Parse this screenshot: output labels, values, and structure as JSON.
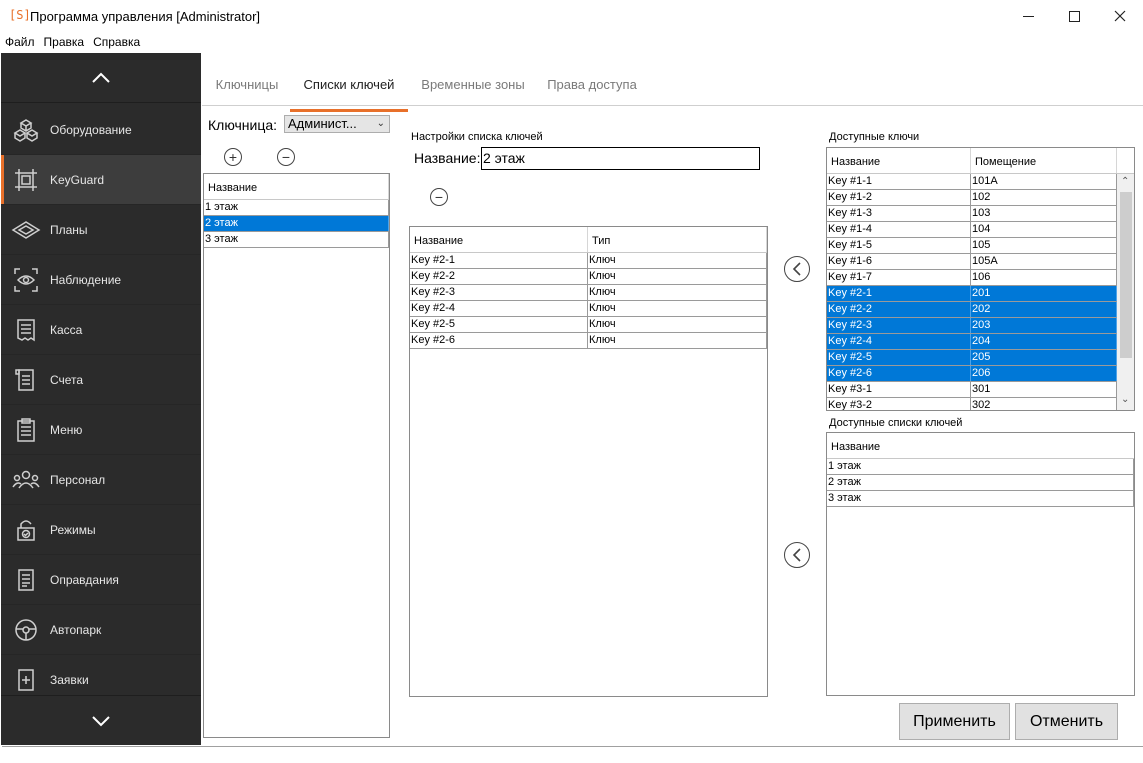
{
  "window": {
    "logo": "[S]",
    "title": "Программа управления [Administrator]"
  },
  "menu": [
    "Файл",
    "Правка",
    "Справка"
  ],
  "sidebar": {
    "items": [
      {
        "label": "Оборудование",
        "icon": "equipment-icon"
      },
      {
        "label": "KeyGuard",
        "icon": "keyguard-icon",
        "active": true
      },
      {
        "label": "Планы",
        "icon": "plans-icon"
      },
      {
        "label": "Наблюдение",
        "icon": "eye-icon"
      },
      {
        "label": "Касса",
        "icon": "receipt-icon"
      },
      {
        "label": "Счета",
        "icon": "invoice-icon"
      },
      {
        "label": "Меню",
        "icon": "clipboard-icon"
      },
      {
        "label": "Персонал",
        "icon": "people-icon"
      },
      {
        "label": "Режимы",
        "icon": "lock-check-icon"
      },
      {
        "label": "Оправдания",
        "icon": "document-icon"
      },
      {
        "label": "Автопарк",
        "icon": "steering-wheel-icon"
      },
      {
        "label": "Заявки",
        "icon": "request-icon"
      }
    ]
  },
  "tabs": [
    "Ключницы",
    "Списки ключей",
    "Временные зоны",
    "Права доступа"
  ],
  "left_panel": {
    "label": "Ключница:",
    "select_value": "Админист...",
    "list_header": "Название",
    "rows": [
      "1 этаж",
      "2 этаж",
      "3 этаж"
    ],
    "selected_index": 1
  },
  "settings": {
    "section_title": "Настройки списка ключей",
    "name_label": "Название:",
    "name_value": "2 этаж",
    "headers": [
      "Название",
      "Тип"
    ],
    "rows": [
      [
        "Key #2-1",
        "Ключ"
      ],
      [
        "Key #2-2",
        "Ключ"
      ],
      [
        "Key #2-3",
        "Ключ"
      ],
      [
        "Key #2-4",
        "Ключ"
      ],
      [
        "Key #2-5",
        "Ключ"
      ],
      [
        "Key #2-6",
        "Ключ"
      ]
    ]
  },
  "available_keys": {
    "title": "Доступные ключи",
    "headers": [
      "Название",
      "Помещение"
    ],
    "rows": [
      [
        "Key #1-1",
        "101A"
      ],
      [
        "Key #1-2",
        "102"
      ],
      [
        "Key #1-3",
        "103"
      ],
      [
        "Key #1-4",
        "104"
      ],
      [
        "Key #1-5",
        "105"
      ],
      [
        "Key #1-6",
        "105A"
      ],
      [
        "Key #1-7",
        "106"
      ],
      [
        "Key #2-1",
        "201"
      ],
      [
        "Key #2-2",
        "202"
      ],
      [
        "Key #2-3",
        "203"
      ],
      [
        "Key #2-4",
        "204"
      ],
      [
        "Key #2-5",
        "205"
      ],
      [
        "Key #2-6",
        "206"
      ],
      [
        "Key #3-1",
        "301"
      ],
      [
        "Key #3-2",
        "302"
      ]
    ],
    "selected_rows": [
      7,
      8,
      9,
      10,
      11,
      12
    ]
  },
  "available_lists": {
    "title": "Доступные списки ключей",
    "header": "Название",
    "rows": [
      "1 этаж",
      "2 этаж",
      "3 этаж"
    ]
  },
  "buttons": {
    "apply": "Применить",
    "cancel": "Отменить"
  },
  "colors": {
    "accent": "#e8702a",
    "selection": "#0078d7",
    "sidebar_bg": "#2b2b2b"
  }
}
